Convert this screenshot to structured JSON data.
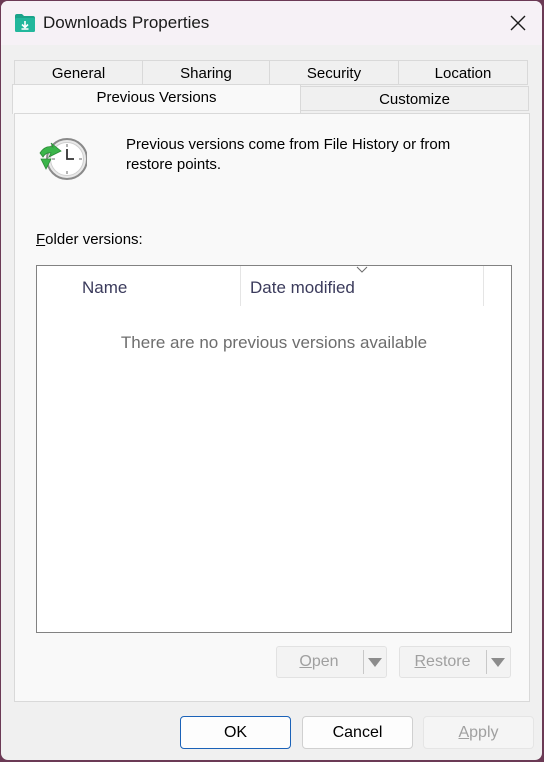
{
  "window": {
    "title": "Downloads Properties",
    "folder_icon": "download-folder-icon",
    "close_icon": "close-icon"
  },
  "tabs": {
    "row1": [
      "General",
      "Sharing",
      "Security",
      "Location"
    ],
    "row2": [
      "Previous Versions",
      "Customize"
    ],
    "active": "Previous Versions"
  },
  "info": {
    "icon": "history-clock-icon",
    "text": "Previous versions come from File History or from restore points."
  },
  "folder_versions": {
    "label_mnemonic": "F",
    "label_rest": "older versions:",
    "columns": [
      "Name",
      "Date modified"
    ],
    "sort_column": "Date modified",
    "empty_message": "There are no previous versions available"
  },
  "actions": {
    "open": {
      "mnemonic": "O",
      "rest": "pen",
      "enabled": false
    },
    "restore": {
      "mnemonic": "R",
      "rest": "estore",
      "enabled": false
    }
  },
  "footer": {
    "ok": "OK",
    "cancel": "Cancel",
    "apply_mnemonic": "A",
    "apply_rest": "pply",
    "apply_enabled": false
  },
  "colors": {
    "folder_teal": "#1aa38a",
    "clock_green": "#3bb54a",
    "default_button_border": "#1b62b8"
  }
}
